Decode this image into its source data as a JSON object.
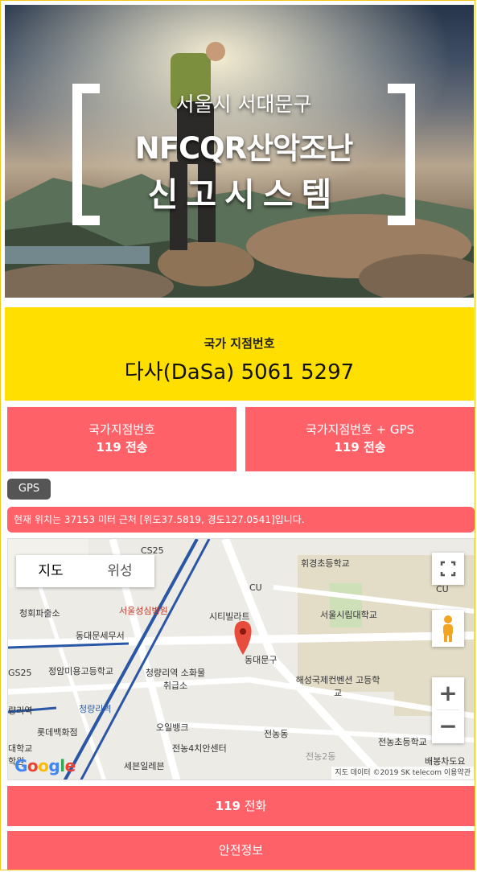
{
  "banner": {
    "line1": "서울시 서대문구",
    "line2": "NFCQR산악조난",
    "line3": "신고시스템"
  },
  "point": {
    "label": "국가 지점번호",
    "value": "다사(DaSa) 5061 5297"
  },
  "send_buttons": [
    {
      "line1": "국가지점번호",
      "line2": "119 전송"
    },
    {
      "line1": "국가지점번호 + GPS",
      "line2": "119 전송"
    }
  ],
  "gps_badge": "GPS",
  "location_text": "현재 위치는 37153 미터 근처 [위도37.5819, 경도127.0541]입니다.",
  "map": {
    "type_map": "지도",
    "type_satellite": "위성",
    "logo": "Google",
    "attribution": "지도 데이터 ©2019 SK telecom   이용약관",
    "labels": {
      "cs25": "CS25",
      "hwigyeong": "휘경초등학교",
      "cu1": "CU",
      "cu2": "CU",
      "cheongho": "청회파출소",
      "seoulsungsim": "서울성심병원",
      "citypark": "시티빌라트",
      "siripdae": "서울시립대학교",
      "dongdaemun_tax": "동대문세무서",
      "gs25": "GS25",
      "jeongam": "정암미용고등학교",
      "cheongnyangni_sobang": "청량리역 소화물취급소",
      "dongdaemungu": "동대문구",
      "haesung": "해성국제컨벤션 고등학교",
      "station": "량리역",
      "cheongnyangni": "청량리역",
      "lotte": "롯데백화점",
      "obank": "오일뱅크",
      "jeonnong": "전농동",
      "jeonnong_elem": "전농초등학교",
      "school_left": "대학교 학원",
      "jeonnong4": "전농4치안센터",
      "jeonnong2": "전농2동",
      "sebang": "세븐일레븐",
      "baebong": "배봉차도요"
    }
  },
  "buttons": {
    "call_num": "119",
    "call_text": " 전화",
    "safety": "안전정보"
  },
  "colors": {
    "accent_red": "#ff6168",
    "yellow": "#ffdf00",
    "border": "#f3c81a"
  }
}
